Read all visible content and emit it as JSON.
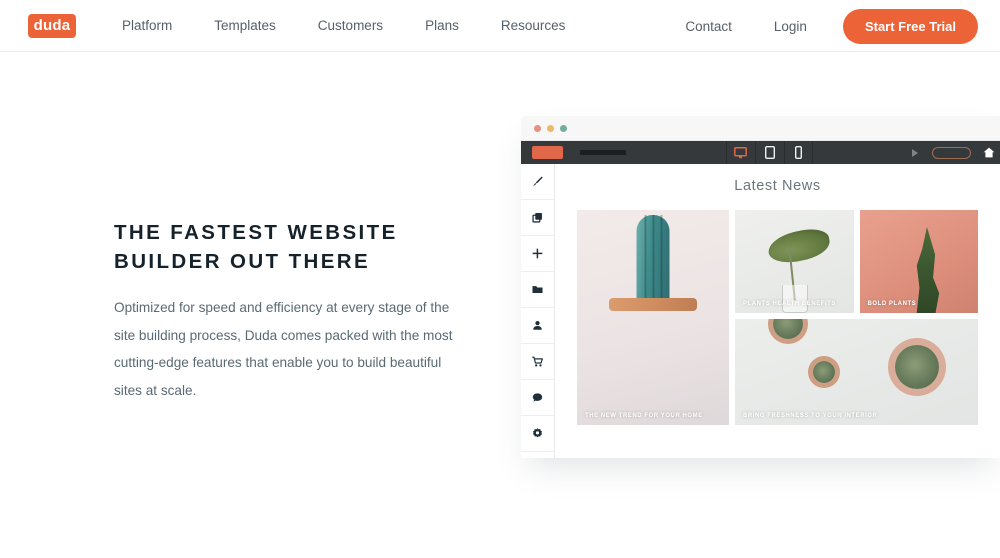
{
  "header": {
    "logo_text": "duda",
    "nav": [
      {
        "label": "Platform"
      },
      {
        "label": "Templates"
      },
      {
        "label": "Customers"
      },
      {
        "label": "Plans"
      },
      {
        "label": "Resources"
      }
    ],
    "right_links": [
      {
        "label": "Contact"
      },
      {
        "label": "Login"
      }
    ],
    "cta_label": "Start Free Trial",
    "accent_color": "#ec6338"
  },
  "hero": {
    "headline": "THE FASTEST WEBSITE BUILDER OUT THERE",
    "body": "Optimized for speed and efficiency at every stage of the site building process, Duda comes packed with the most cutting-edge features that enable you to build beautiful sites at scale."
  },
  "mockup": {
    "window_dots": [
      {
        "name": "close-dot",
        "color": "#e89080"
      },
      {
        "name": "minimize-dot",
        "color": "#ecb86a"
      },
      {
        "name": "maximize-dot",
        "color": "#74ad9b"
      }
    ],
    "toolbar": {
      "devices": [
        {
          "name": "desktop-view-icon",
          "active": true
        },
        {
          "name": "tablet-view-icon",
          "active": false
        },
        {
          "name": "mobile-view-icon",
          "active": false
        }
      ],
      "play_icon": "play-icon",
      "publish_pill": "publish-button",
      "home_icon": "home-icon",
      "bar_color": "#35393c"
    },
    "sidebar": [
      {
        "name": "design-brush-icon"
      },
      {
        "name": "pages-layers-icon"
      },
      {
        "name": "add-plus-icon"
      },
      {
        "name": "files-folder-icon"
      },
      {
        "name": "members-person-icon"
      },
      {
        "name": "store-cart-icon"
      },
      {
        "name": "chat-bubble-icon"
      },
      {
        "name": "settings-gear-icon"
      }
    ],
    "canvas": {
      "title": "Latest News",
      "cards": [
        {
          "id": "cactus",
          "caption": "THE NEW TREND FOR YOUR HOME"
        },
        {
          "id": "leaf",
          "caption": "PLANTS HEALTH BENEFITS"
        },
        {
          "id": "bold",
          "caption": "BOLD PLANTS"
        },
        {
          "id": "succulents",
          "caption": "BRING FRESHNESS TO YOUR INTERIOR"
        }
      ]
    }
  }
}
